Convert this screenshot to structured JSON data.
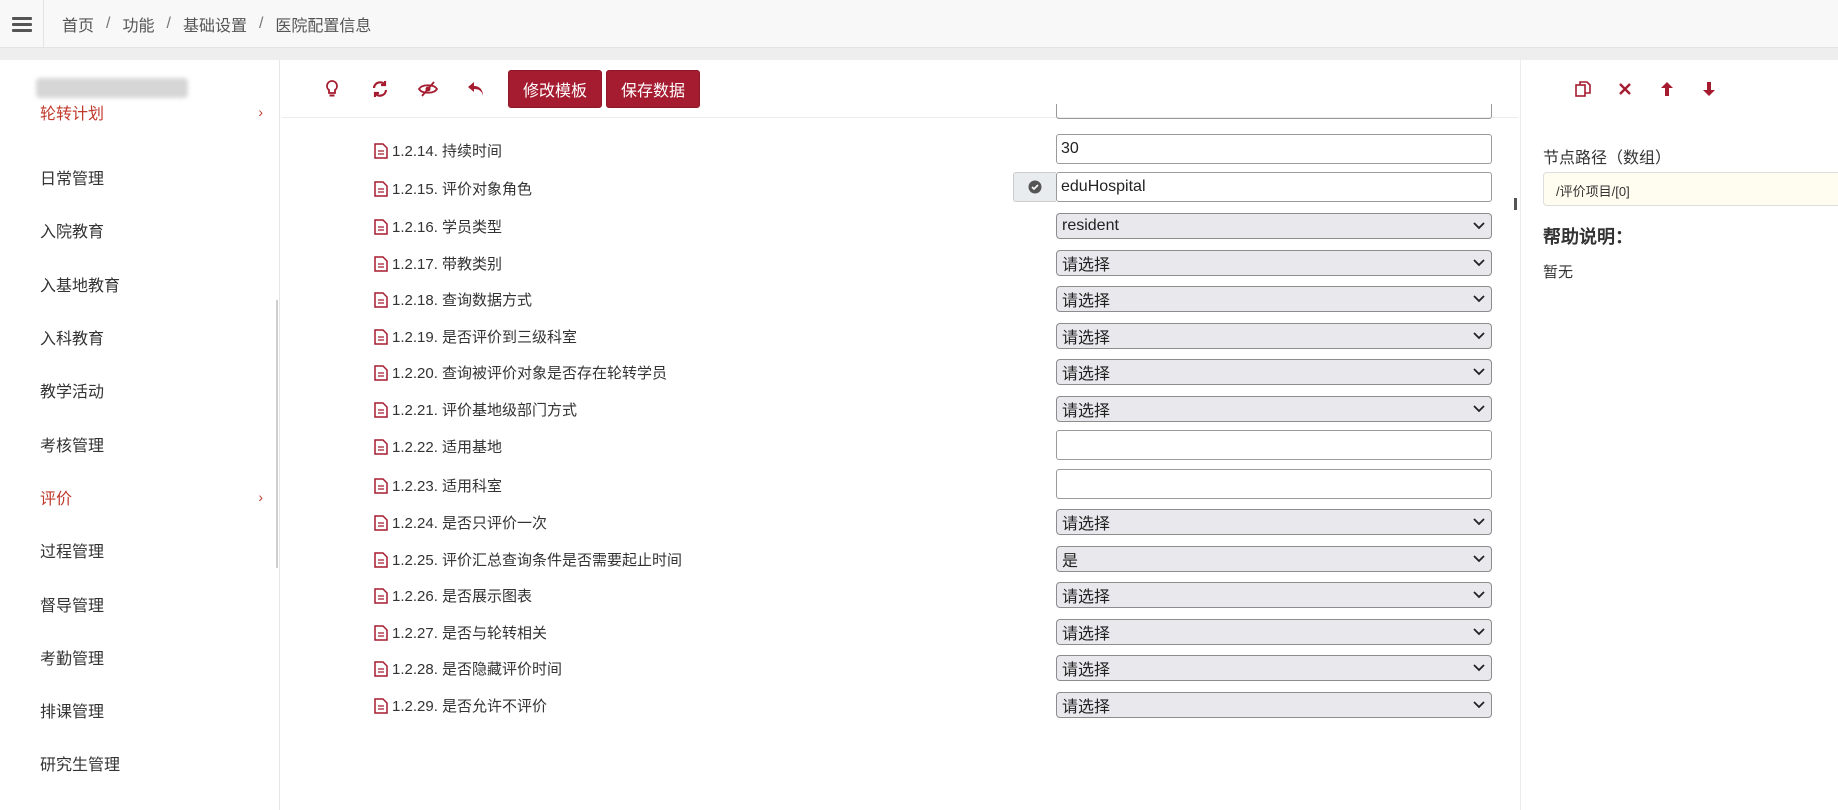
{
  "breadcrumb": [
    "首页",
    "功能",
    "基础设置",
    "医院配置信息"
  ],
  "breadcrumb_sep": "/",
  "sidebar": {
    "items": [
      {
        "label": "轮转计划",
        "active": true,
        "has_arrow": true
      },
      {
        "label": "日常管理"
      },
      {
        "label": "入院教育"
      },
      {
        "label": "入基地教育"
      },
      {
        "label": "入科教育"
      },
      {
        "label": "教学活动"
      },
      {
        "label": "考核管理"
      },
      {
        "label": "评价",
        "active": true,
        "has_arrow": true
      },
      {
        "label": "过程管理"
      },
      {
        "label": "督导管理"
      },
      {
        "label": "考勤管理"
      },
      {
        "label": "排课管理"
      },
      {
        "label": "研究生管理"
      }
    ],
    "arrow_glyph": "›"
  },
  "toolbar": {
    "icons": [
      "lightbulb-icon",
      "refresh-icon",
      "eye-slash-icon",
      "undo-icon"
    ],
    "edit_template_label": "修改模板",
    "save_data_label": "保存数据"
  },
  "form_rows": [
    {
      "label": "1.2.14. 持续时间",
      "type": "input",
      "value": "30"
    },
    {
      "label": "1.2.15. 评价对象角色",
      "type": "input",
      "value": "eduHospital",
      "addon": "check-circle-icon"
    },
    {
      "label": "1.2.16. 学员类型",
      "type": "select",
      "value": "resident"
    },
    {
      "label": "1.2.17. 带教类别",
      "type": "select",
      "value": "请选择"
    },
    {
      "label": "1.2.18. 查询数据方式",
      "type": "select",
      "value": "请选择"
    },
    {
      "label": "1.2.19. 是否评价到三级科室",
      "type": "select",
      "value": "请选择"
    },
    {
      "label": "1.2.20. 查询被评价对象是否存在轮转学员",
      "type": "select",
      "value": "请选择"
    },
    {
      "label": "1.2.21. 评价基地级部门方式",
      "type": "select",
      "value": "请选择"
    },
    {
      "label": "1.2.22. 适用基地",
      "type": "input",
      "value": ""
    },
    {
      "label": "1.2.23. 适用科室",
      "type": "input",
      "value": ""
    },
    {
      "label": "1.2.24. 是否只评价一次",
      "type": "select",
      "value": "请选择"
    },
    {
      "label": "1.2.25. 评价汇总查询条件是否需要起止时间",
      "type": "select",
      "value": "是"
    },
    {
      "label": "1.2.26. 是否展示图表",
      "type": "select",
      "value": "请选择"
    },
    {
      "label": "1.2.27. 是否与轮转相关",
      "type": "select",
      "value": "请选择"
    },
    {
      "label": "1.2.28. 是否隐藏评价时间",
      "type": "select",
      "value": "请选择"
    },
    {
      "label": "1.2.29. 是否允许不评价",
      "type": "select",
      "value": "请选择"
    }
  ],
  "right_panel": {
    "icons": [
      "copy-icon",
      "close-icon",
      "arrow-up-icon",
      "arrow-down-icon"
    ],
    "node_path_label": "节点路径（数组）",
    "node_path_value": "/评价项目/[0]",
    "help_title": "帮助说明：",
    "help_text": "暂无"
  },
  "colors": {
    "accent": "#a51c30",
    "active_text": "#c0392b",
    "select_bg": "#e9e9ed",
    "path_box_bg": "#fffdf0"
  }
}
